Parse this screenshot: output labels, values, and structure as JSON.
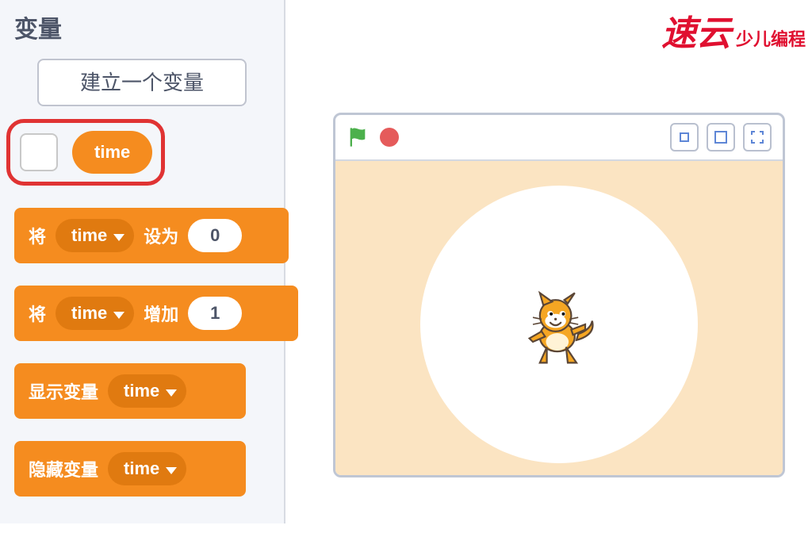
{
  "logo": {
    "brand": "速云",
    "tagline": "少儿编程"
  },
  "panel": {
    "title": "变量",
    "make_variable_label": "建立一个变量",
    "variable_name": "time",
    "blocks": {
      "set": {
        "prefix": "将",
        "var": "time",
        "suffix": "设为",
        "value": "0"
      },
      "change": {
        "prefix": "将",
        "var": "time",
        "suffix": "增加",
        "value": "1"
      },
      "show": {
        "prefix": "显示变量",
        "var": "time"
      },
      "hide": {
        "prefix": "隐藏变量",
        "var": "time"
      }
    }
  },
  "stage": {
    "flag_color": "#4cb04c",
    "stop_color": "#e55b5b",
    "bg_color": "#fbe4c2"
  }
}
